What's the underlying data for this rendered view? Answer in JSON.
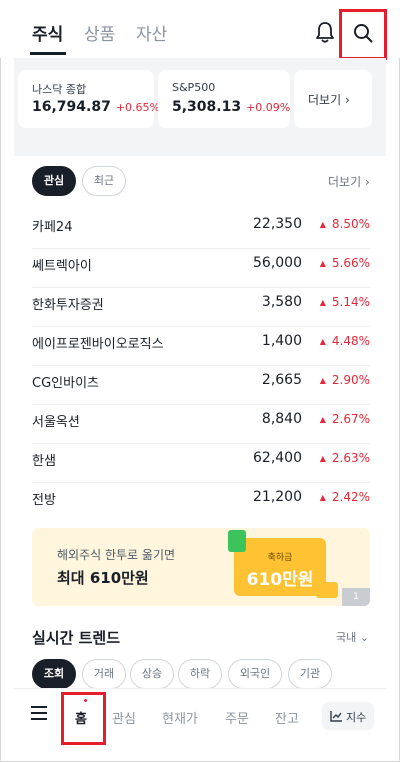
{
  "header": {
    "tabs": [
      "주식",
      "상품",
      "자산"
    ],
    "icons": [
      "bell-icon",
      "search-icon"
    ]
  },
  "indices": [
    {
      "name": "나스닥 종합",
      "value": "16,794.87",
      "change": "+0.65%"
    },
    {
      "name": "S&P500",
      "value": "5,308.13",
      "change": "+0.09%"
    }
  ],
  "index_more": "더보기",
  "watchlist": {
    "chips": [
      "관심",
      "최근"
    ],
    "more": "더보기",
    "rows": [
      {
        "name": "카페24",
        "price": "22,350",
        "change": "8.50%"
      },
      {
        "name": "쎄트렉아이",
        "price": "56,000",
        "change": "5.66%"
      },
      {
        "name": "한화투자증권",
        "price": "3,580",
        "change": "5.14%"
      },
      {
        "name": "에이프로젠바이오로직스",
        "price": "1,400",
        "change": "4.48%"
      },
      {
        "name": "CG인바이츠",
        "price": "2,665",
        "change": "2.90%"
      },
      {
        "name": "서울옥션",
        "price": "8,840",
        "change": "2.67%"
      },
      {
        "name": "한샘",
        "price": "62,400",
        "change": "2.63%"
      },
      {
        "name": "전방",
        "price": "21,200",
        "change": "2.42%"
      }
    ]
  },
  "banner": {
    "line1": "해외주식 한투로 옮기면",
    "line2": "최대 610만원",
    "ticket_top": "축하금",
    "ticket_amount": "610만원",
    "page": "1"
  },
  "trend": {
    "title": "실시간 트렌드",
    "region": "국내",
    "chips": [
      "조회",
      "거래",
      "상승",
      "하락",
      "외국인",
      "기관"
    ]
  },
  "bottom_nav": {
    "items": [
      "홈",
      "관심",
      "현재가",
      "주문",
      "잔고"
    ],
    "index_button": "지수"
  },
  "colors": {
    "up": "#e42939",
    "highlight_box": "#e41e2b",
    "text": "#191f28"
  }
}
